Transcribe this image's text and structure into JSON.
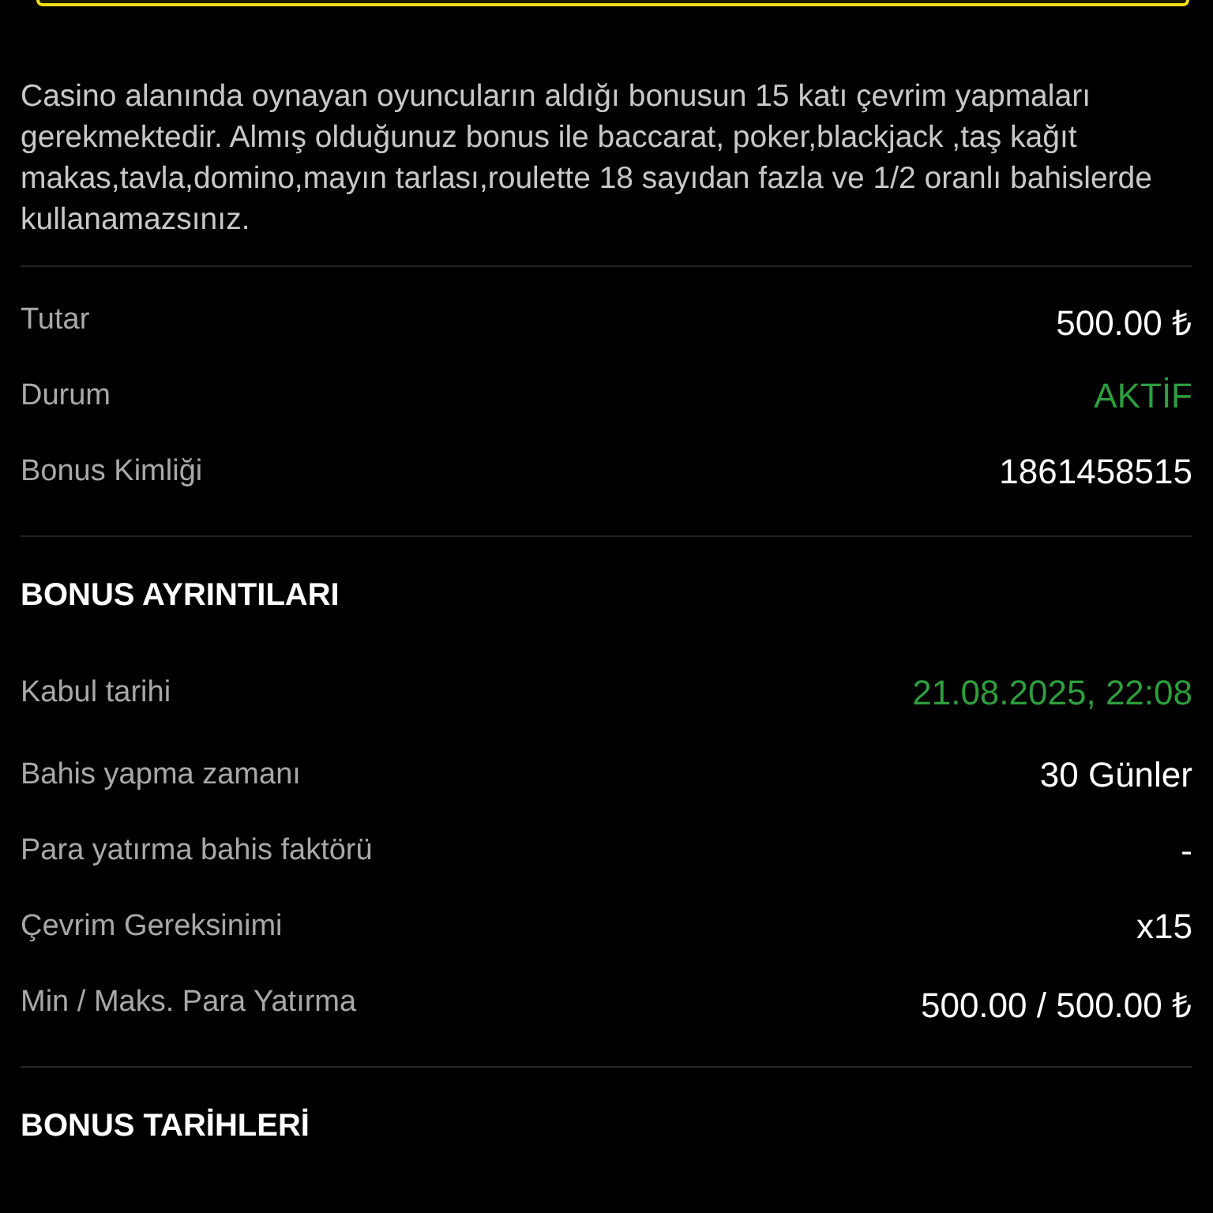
{
  "description": "Casino alanında oynayan oyuncuların aldığı bonusun 15 katı çevrim yapmaları gerekmektedir. Almış olduğunuz bonus ile baccarat, poker,blackjack ,taş kağıt makas,tavla,domino,mayın tarlası,roulette 18 sayıdan fazla ve 1/2 oranlı bahislerde kullanamazsınız.",
  "summary": [
    {
      "label": "Tutar",
      "value": "500.00 ₺",
      "color": "#ffffff"
    },
    {
      "label": "Durum",
      "value": "AKTİF",
      "color": "#2e9e3e"
    },
    {
      "label": "Bonus Kimliği",
      "value": "1861458515",
      "color": "#ffffff"
    }
  ],
  "sections": [
    {
      "title": "BONUS AYRINTILARI",
      "rows": [
        {
          "label": "Kabul tarihi",
          "value": "21.08.2025, 22:08",
          "color": "#2e9e3e"
        },
        {
          "label": "Bahis yapma zamanı",
          "value": "30 Günler",
          "color": "#ffffff"
        },
        {
          "label": "Para yatırma bahis faktörü",
          "value": "-",
          "color": "#ffffff"
        },
        {
          "label": "Çevrim Gereksinimi",
          "value": "x15",
          "color": "#ffffff"
        },
        {
          "label": "Min / Maks. Para Yatırma",
          "value": "500.00 / 500.00 ₺",
          "color": "#ffffff"
        }
      ]
    },
    {
      "title": "BONUS TARİHLERİ"
    }
  ]
}
